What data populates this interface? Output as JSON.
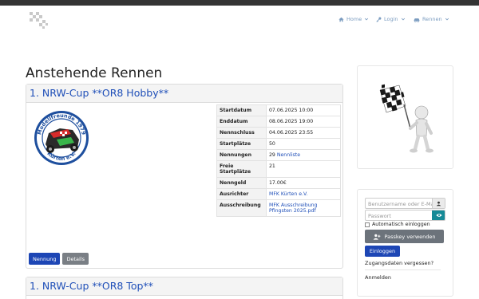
{
  "nav": {
    "home": "Home",
    "login": "Login",
    "races": "Rennen"
  },
  "page": {
    "title": "Anstehende Rennen"
  },
  "races": [
    {
      "title": "1. NRW-Cup **OR8 Hobby**",
      "details": {
        "start_label": "Startdatum",
        "start": "07.06.2025 10:00",
        "end_label": "Enddatum",
        "end": "08.06.2025 19:00",
        "close_label": "Nennschluss",
        "close": "04.06.2025 23:55",
        "slots_label": "Startplätze",
        "slots": "50",
        "entries_label": "Nennungen",
        "entries_count": "29",
        "entries_link": "Nennliste",
        "free_label": "Freie Startplätze",
        "free": "21",
        "fee_label": "Nenngeld",
        "fee": "17.00€",
        "organizer_label": "Ausrichter",
        "organizer": "MFK Kürten e.V.",
        "tender_label": "Ausschreibung",
        "tender": "MFK Ausschreibung Pfingsten 2025.pdf"
      },
      "buttons": {
        "enter": "Nennung",
        "details": "Details"
      }
    },
    {
      "title": "1. NRW-Cup **OR8 Top**"
    }
  ],
  "login": {
    "username_placeholder": "Benutzername oder E-Mail",
    "password_placeholder": "Passwort",
    "auto_login": "Automatisch einloggen",
    "passkey": "Passkey verwenden",
    "submit": "Einloggen",
    "forgot": "Zugangsdaten vergessen?",
    "register": "Anmelden"
  },
  "club_logo": {
    "ring_top": "Modellfreunde 1979",
    "ring_bottom": "Kürten e.V."
  },
  "colors": {
    "primary": "#1d46b5",
    "secondary": "#7a7f85",
    "teal": "#168a97",
    "nav": "#7b9cc0",
    "title_link": "#1f4fb8"
  }
}
